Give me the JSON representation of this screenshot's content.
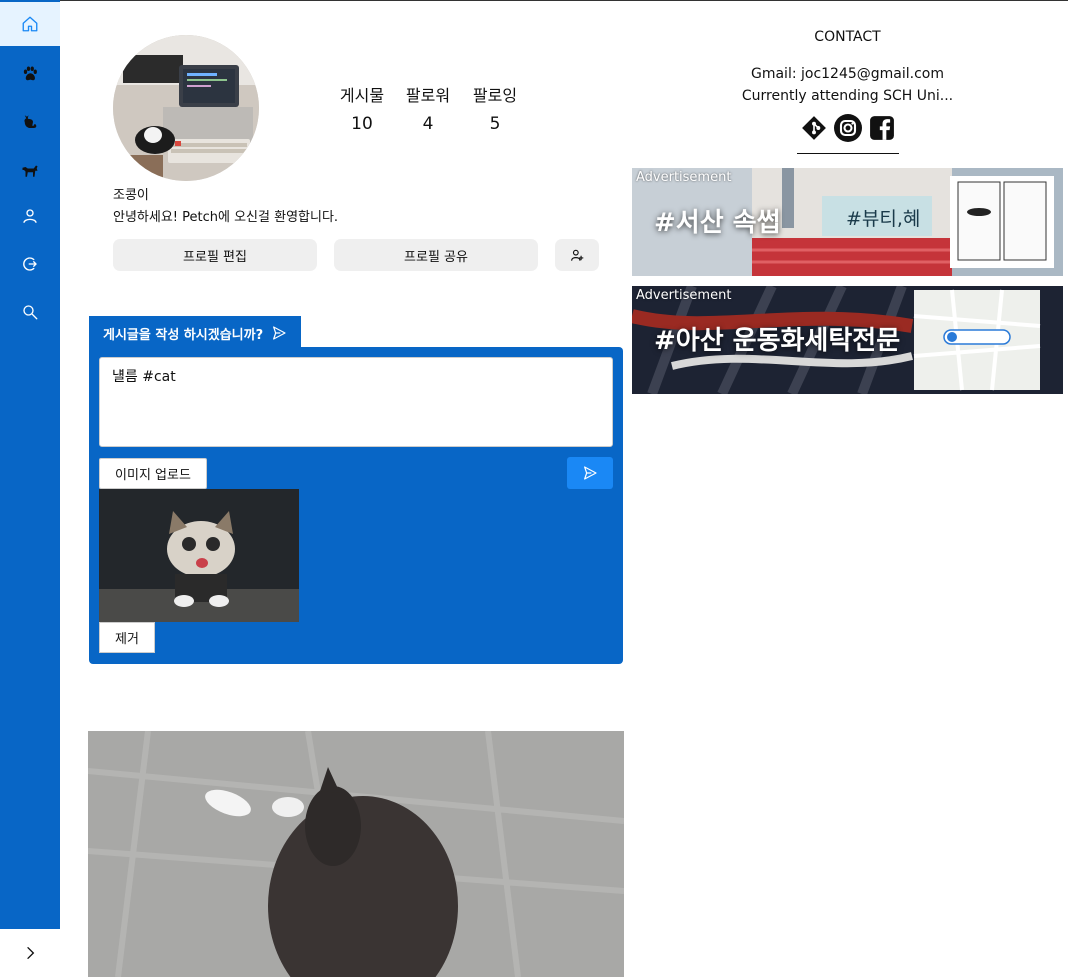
{
  "profile": {
    "username": "조콩이",
    "bio": "안녕하세요! Petch에 오신걸 환영합니다.",
    "stats": [
      {
        "label": "게시물",
        "value": "10"
      },
      {
        "label": "팔로워",
        "value": "4"
      },
      {
        "label": "팔로잉",
        "value": "5"
      }
    ],
    "edit_button": "프로필 편집",
    "share_button": "프로필 공유"
  },
  "composer": {
    "tab_label": "게시글을 작성 하시겠습니까?",
    "text_value": "냴름 #cat",
    "upload_button": "이미지 업로드",
    "remove_button": "제거"
  },
  "contact": {
    "title": "CONTACT",
    "email": "Gmail: joc1245@gmail.com",
    "status": "Currently attending SCH Uni...",
    "social_icons": [
      "git-icon",
      "instagram-icon",
      "facebook-icon"
    ]
  },
  "ads": [
    {
      "label": "Advertisement",
      "text": "#서산 속썹",
      "sign_text": "#뷰티,혜"
    },
    {
      "label": "Advertisement",
      "text": "#아산 운동화세탁전문"
    }
  ],
  "sidebar": {
    "icons": [
      "home-icon",
      "paw-icon",
      "cat-icon",
      "dog-icon",
      "user-icon",
      "logout-icon",
      "search-icon"
    ],
    "expand_icon": "chevron-right-icon"
  },
  "colors": {
    "sidebar": "#0866c6",
    "composer": "#0866c6",
    "send_button": "#1a88f5",
    "active_item": "#e6f3ff"
  }
}
